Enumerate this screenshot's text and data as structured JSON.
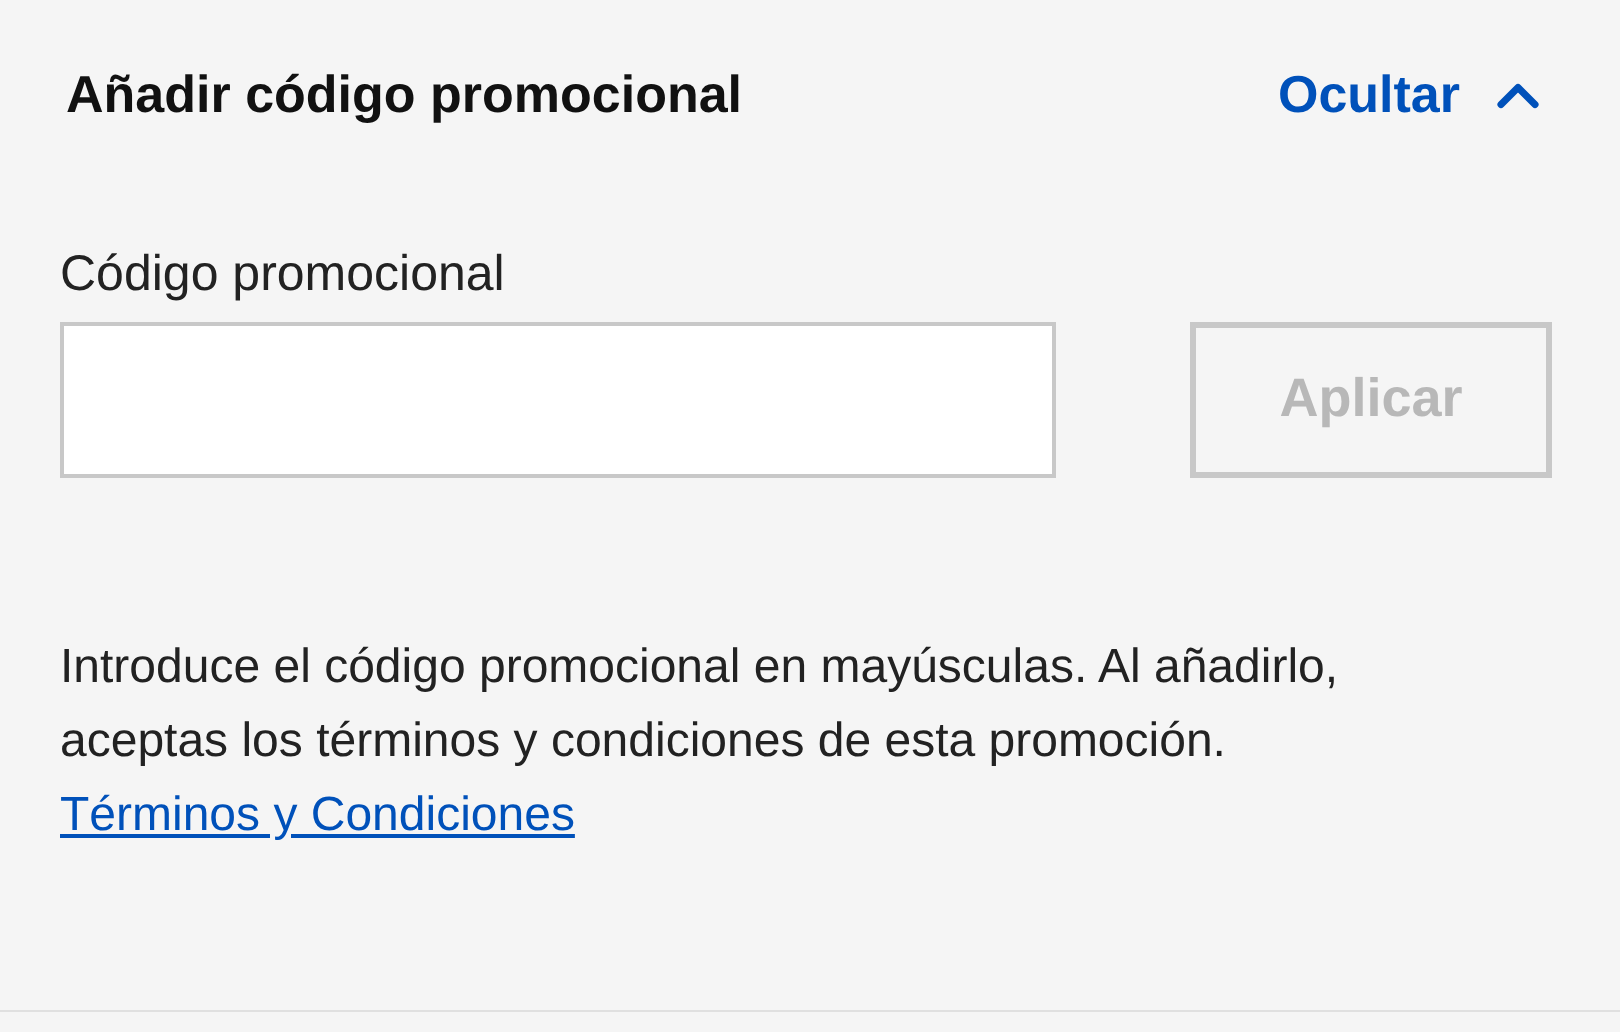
{
  "header": {
    "title": "Añadir código promocional",
    "toggle": {
      "label": "Ocultar",
      "expanded": true
    }
  },
  "promo_field": {
    "label": "Código promocional"
  },
  "apply_button": {
    "label": "Aplicar",
    "disabled": true
  },
  "description": "Introduce el código promocional en mayúsculas. Al añadirlo, aceptas los términos y condiciones de esta promoción.",
  "terms_link": "Términos y Condiciones"
}
